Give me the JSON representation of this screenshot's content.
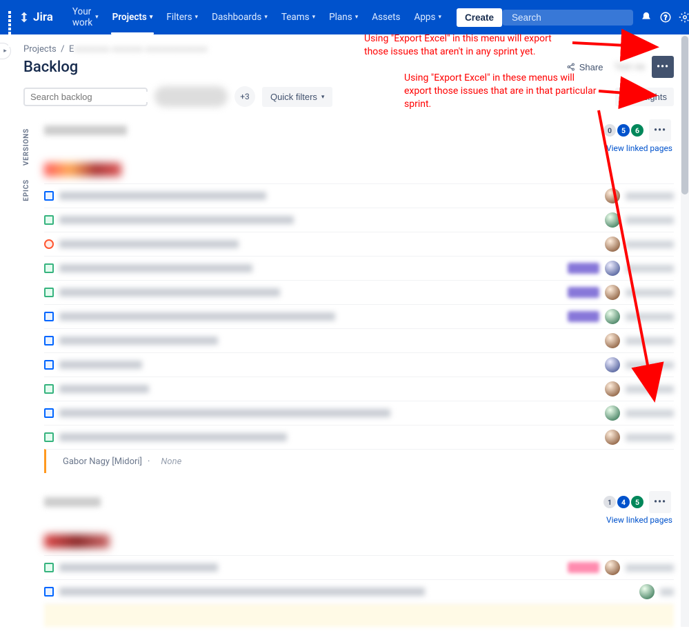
{
  "nav": {
    "brand": "Jira",
    "your_work": "Your work",
    "projects": "Projects",
    "filters": "Filters",
    "dashboards": "Dashboards",
    "teams": "Teams",
    "plans": "Plans",
    "assets": "Assets",
    "apps": "Apps",
    "create": "Create",
    "search_placeholder": "Search"
  },
  "breadcrumb": {
    "root": "Projects",
    "sep": "/",
    "current": "E"
  },
  "view": {
    "title": "Backlog",
    "share": "Share",
    "test_view": "Test vie",
    "insights": "Insights",
    "search_placeholder": "Search backlog",
    "plus_avatars": "+3",
    "quick_filters": "Quick filters",
    "versions_tab": "VERSIONS",
    "epics_tab": "EPICS",
    "view_linked": "View linked pages"
  },
  "sprint1": {
    "counts": {
      "todo": "0",
      "inprog": "5",
      "done": "6"
    }
  },
  "sprint2": {
    "counts": {
      "todo": "1",
      "inprog": "4",
      "done": "5"
    }
  },
  "last_row": {
    "author": "Gabor Nagy [Midori]",
    "sep": "·",
    "none": "None"
  },
  "annotations": {
    "top": "Using \"Export Excel\" in this menu will export those issues that aren't in any sprint yet.",
    "bottom": "Using \"Export Excel\" in these menus will export those issues that are in that particular sprint."
  }
}
